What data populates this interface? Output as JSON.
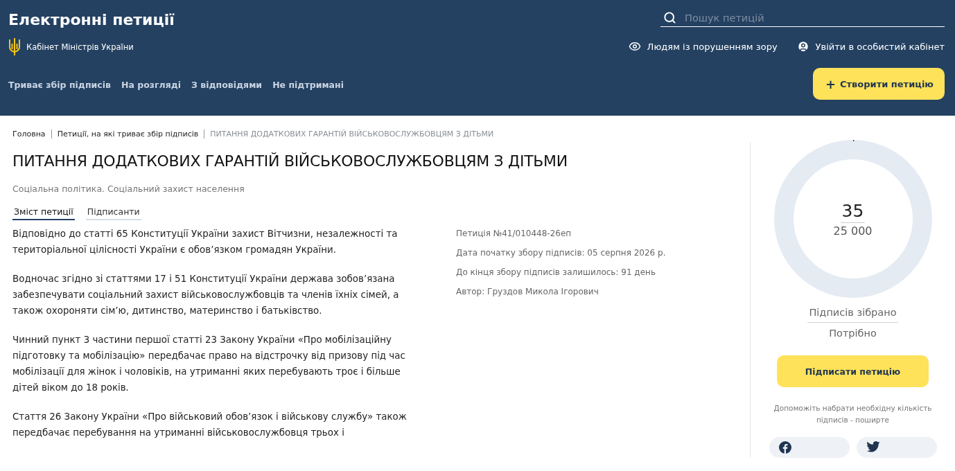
{
  "header": {
    "title": "Електронні петиції",
    "org": "Кабінет Міністрів України",
    "search": {
      "placeholder": "Пошук петицій"
    },
    "links": [
      {
        "kind": "accessibility",
        "label": "Людям із порушенням зору"
      },
      {
        "kind": "login",
        "label": "Увійти в особистий кабінет"
      }
    ],
    "nav": [
      "Триває збір підписів",
      "На розгляді",
      "З відповідями",
      "Не підтримані"
    ],
    "create_button": {
      "icon": "+",
      "label": "Створити петицію"
    }
  },
  "breadcrumbs": [
    {
      "label": "Головна",
      "current": false
    },
    {
      "label": "Петиції, на які триває збір підписів",
      "current": false
    },
    {
      "label": "ПИТАННЯ ДОДАТКОВИХ ГАРАНТІЙ ВІЙСЬКОВОСЛУЖБОВЦЯМ З ДІТЬМИ",
      "current": true
    }
  ],
  "petition": {
    "title": "ПИТАННЯ ДОДАТКОВИХ ГАРАНТІЙ ВІЙСЬКОВОСЛУЖБОВЦЯМ З ДІТЬМИ",
    "category": "Соціальна політика. Соціальний захист населення",
    "tabs": [
      {
        "label": "Зміст петиції",
        "selected": true
      },
      {
        "label": "Підписанти",
        "selected": false
      }
    ],
    "paragraphs": [
      "Відповідно до статті 65 Конституції України захист Вітчизни, незалежності та територіальної цілісності України є обов’язком громадян України.",
      "Водночас згідно зі статтями 17 і 51 Конституції України держава зобов’язана забезпечувати соціальний захист військовослужбовців та членів їхніх сімей, а також охороняти сім’ю, дитинство, материнство і батьківство.",
      "Чинний пункт 3 частини першої статті 23 Закону України «Про мобілізаційну підготовку та мобілізацію» передбачає право на відстрочку від призову під час мобілізації для жінок і чоловіків, на утриманні яких перебувають троє і більше дітей віком до 18 років.",
      "Стаття 26 Закону України «Про військовий обов’язок і військову службу» також передбачає перебування на утриманні військовослужбовця трьох і"
    ],
    "meta": [
      "Петиція №41/010448-26еп",
      "Дата початку збору підписів: 05 серпня 2026 р.",
      "До кінця збору підписів залишилось: 91 день",
      "Автор: Груздов Микола Ігорович"
    ]
  },
  "sidebar": {
    "count": "35",
    "goal": "25 000",
    "level": 0.0014,
    "collected_label": "Підписів зібрано",
    "needed_label": "Потрібно",
    "sign_button": "Підписати петицію",
    "share_hint": "Допоможіть набрати необхідну кількість підписів - поширте",
    "share_buttons": [
      {
        "kind": "facebook"
      },
      {
        "kind": "twitter"
      }
    ]
  }
}
